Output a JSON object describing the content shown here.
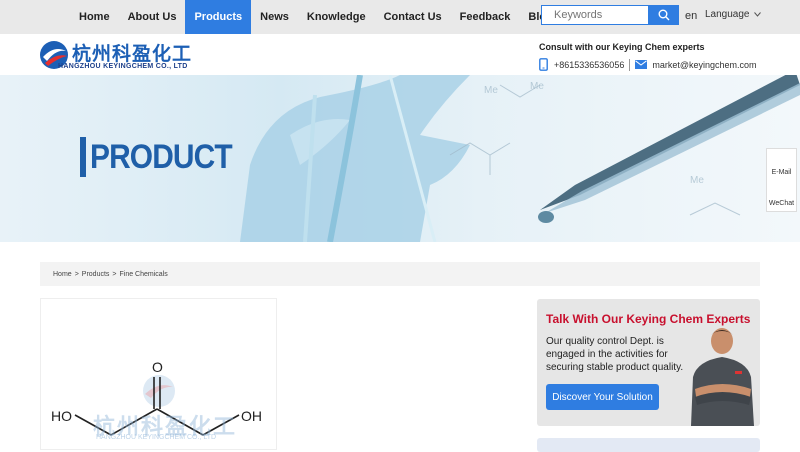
{
  "nav": {
    "items": [
      {
        "label": "Home",
        "active": false
      },
      {
        "label": "About Us",
        "active": false
      },
      {
        "label": "Products",
        "active": true
      },
      {
        "label": "News",
        "active": false
      },
      {
        "label": "Knowledge",
        "active": false
      },
      {
        "label": "Contact Us",
        "active": false
      },
      {
        "label": "Feedback",
        "active": false
      },
      {
        "label": "Blog",
        "active": false
      }
    ],
    "search_placeholder": "Keywords",
    "search_icon": "search-icon",
    "lang_code": "en",
    "language_label": "Language"
  },
  "header": {
    "logo_cn": "杭州科盈化工",
    "logo_en": "HANGZHOU KEYINGCHEM CO., LTD",
    "consult": "Consult with our Keying Chem experts",
    "phone": "+8615336536056",
    "email": "market@keyingchem.com"
  },
  "banner": {
    "title": "PRODUCT"
  },
  "side_float": {
    "email_label": "E-Mail",
    "wechat_label": "WeChat"
  },
  "breadcrumb": [
    "Home",
    ">",
    "Products",
    ">",
    "Fine Chemicals"
  ],
  "product": {
    "label_left": "HO",
    "label_right": "OH",
    "label_top": "O",
    "watermark_cn": "杭州科盈化工",
    "watermark_en": "HANGZHOU KEYINGCHEM CO., LTD"
  },
  "experts": {
    "title": "Talk With Our Keying Chem Experts",
    "desc": "Our quality control Dept. is engaged in the activities for securing stable product quality.",
    "button": "Discover Your Solution"
  },
  "colors": {
    "accent": "#2f7de1",
    "brand_red": "#c8102e",
    "brand_blue": "#1f5fa8"
  }
}
